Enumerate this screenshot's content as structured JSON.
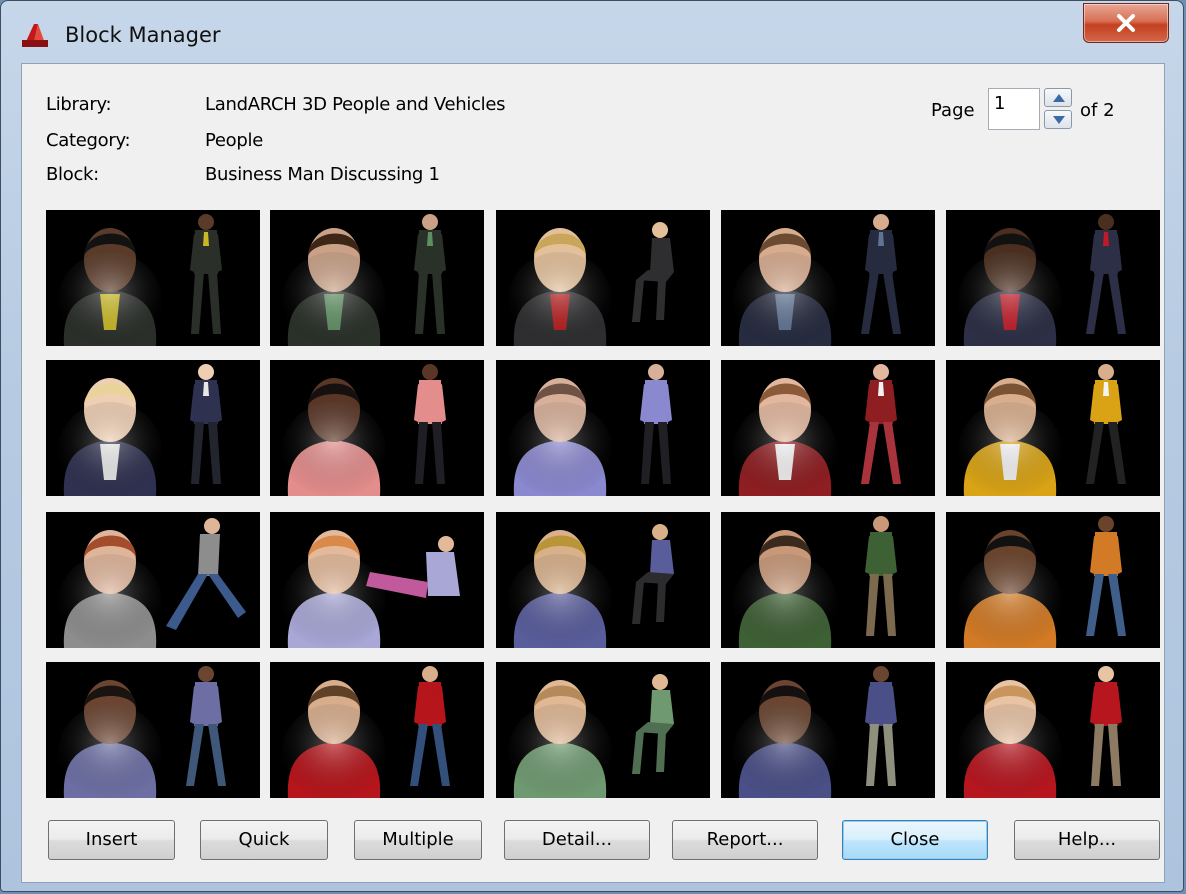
{
  "window": {
    "title": "Block Manager"
  },
  "info": {
    "library_label": "Library:",
    "library_value": "LandARCH 3D People and Vehicles",
    "category_label": "Category:",
    "category_value": "People",
    "block_label": "Block:",
    "block_value": "Business Man Discussing 1"
  },
  "pager": {
    "page_label": "Page",
    "page_value": "1",
    "of_label": "of 2"
  },
  "buttons": {
    "insert": "Insert",
    "quick": "Quick",
    "multiple": "Multiple",
    "detail": "Detail...",
    "report": "Report...",
    "close": "Close",
    "help": "Help..."
  },
  "thumbnails": [
    {
      "pose": "stand",
      "skin": "#5a3a28",
      "hair": "#121212",
      "top": "#2b2f2a",
      "accent": "#c9b823",
      "legs": "#2b2f2a"
    },
    {
      "pose": "stand",
      "skin": "#caa187",
      "hair": "#3d2615",
      "top": "#2a3129",
      "accent": "#5e8f63",
      "legs": "#2a3129"
    },
    {
      "pose": "sit",
      "skin": "#e4c09a",
      "hair": "#c9a65a",
      "top": "#2e2e30",
      "accent": "#b51a1a",
      "legs": "#2e2e30"
    },
    {
      "pose": "walk",
      "skin": "#d7ab8e",
      "hair": "#6a4a30",
      "top": "#262b3f",
      "accent": "#5f7394",
      "legs": "#262b3f"
    },
    {
      "pose": "walk",
      "skin": "#4a2e1f",
      "hair": "#111111",
      "top": "#2c2f45",
      "accent": "#c11a27",
      "legs": "#2c2f45"
    },
    {
      "pose": "stand",
      "skin": "#efcfb3",
      "hair": "#ead39a",
      "top": "#2f3150",
      "accent": "#e8e8e8",
      "legs": "#23252e"
    },
    {
      "pose": "stand",
      "skin": "#5a3626",
      "hair": "#161010",
      "top": "#e38d8c",
      "accent": "#e38d8c",
      "legs": "#1e1e24"
    },
    {
      "pose": "stand",
      "skin": "#d8b09a",
      "hair": "#6e5245",
      "top": "#8a88cf",
      "accent": "#8a88cf",
      "legs": "#1f1f24"
    },
    {
      "pose": "walk",
      "skin": "#e3b79d",
      "hair": "#8b5a39",
      "top": "#8e1e22",
      "accent": "#f2f2f2",
      "legs": "#a8333c"
    },
    {
      "pose": "walk",
      "skin": "#d9ae8c",
      "hair": "#7a5234",
      "top": "#d9a315",
      "accent": "#f3f3f3",
      "legs": "#222222"
    },
    {
      "pose": "run",
      "skin": "#dfb59a",
      "hair": "#a34d2c",
      "top": "#8d8d8d",
      "accent": "#8d8d8d",
      "legs": "#3c5a8c"
    },
    {
      "pose": "lie",
      "skin": "#e3b999",
      "hair": "#d9894a",
      "top": "#a8a7d6",
      "accent": "#a8a7d6",
      "legs": "#c15a9c"
    },
    {
      "pose": "sit",
      "skin": "#d9b089",
      "hair": "#b89638",
      "top": "#595d9c",
      "accent": "#595d9c",
      "legs": "#2c2c2e"
    },
    {
      "pose": "stand",
      "skin": "#c89878",
      "hair": "#3a2a1e",
      "top": "#3e6035",
      "accent": "#3e6035",
      "legs": "#7b6a4e"
    },
    {
      "pose": "walk",
      "skin": "#6a432c",
      "hair": "#111111",
      "top": "#d27a25",
      "accent": "#d27a25",
      "legs": "#3f5f8a"
    },
    {
      "pose": "walk",
      "skin": "#6b4532",
      "hair": "#1a1410",
      "top": "#6d6fa4",
      "accent": "#6d6fa4",
      "legs": "#3f587a"
    },
    {
      "pose": "walk",
      "skin": "#d8ad8c",
      "hair": "#5e4126",
      "top": "#b5151b",
      "accent": "#b5151b",
      "legs": "#33507b"
    },
    {
      "pose": "sit",
      "skin": "#e0b894",
      "hair": "#b48a5a",
      "top": "#6f9a71",
      "accent": "#6f9a71",
      "legs": "#4f6e52"
    },
    {
      "pose": "stand",
      "skin": "#6a4531",
      "hair": "#151010",
      "top": "#4a4f87",
      "accent": "#4a4f87",
      "legs": "#8f8f7e"
    },
    {
      "pose": "stand",
      "skin": "#e8c3a4",
      "hair": "#c9955c",
      "top": "#b7161f",
      "accent": "#b7161f",
      "legs": "#8d7a63"
    }
  ]
}
